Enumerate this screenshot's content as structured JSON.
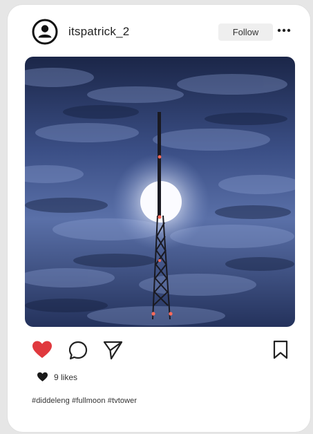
{
  "post": {
    "username": "itspatrick_2",
    "follow_label": "Follow",
    "likes_count": 9,
    "likes_text": "9 likes",
    "caption": "#diddeleng #fullmoon #tvtower",
    "liked": true
  },
  "icons": {
    "avatar": "user-circle-icon",
    "more": "more-horizontal-icon",
    "like": "heart-icon",
    "comment": "comment-bubble-icon",
    "share": "paper-plane-icon",
    "save": "bookmark-icon",
    "likes_marker": "heart-small-icon"
  },
  "colors": {
    "like_active": "#e0393e",
    "card": "#ffffff",
    "follow_bg": "#efefef"
  }
}
